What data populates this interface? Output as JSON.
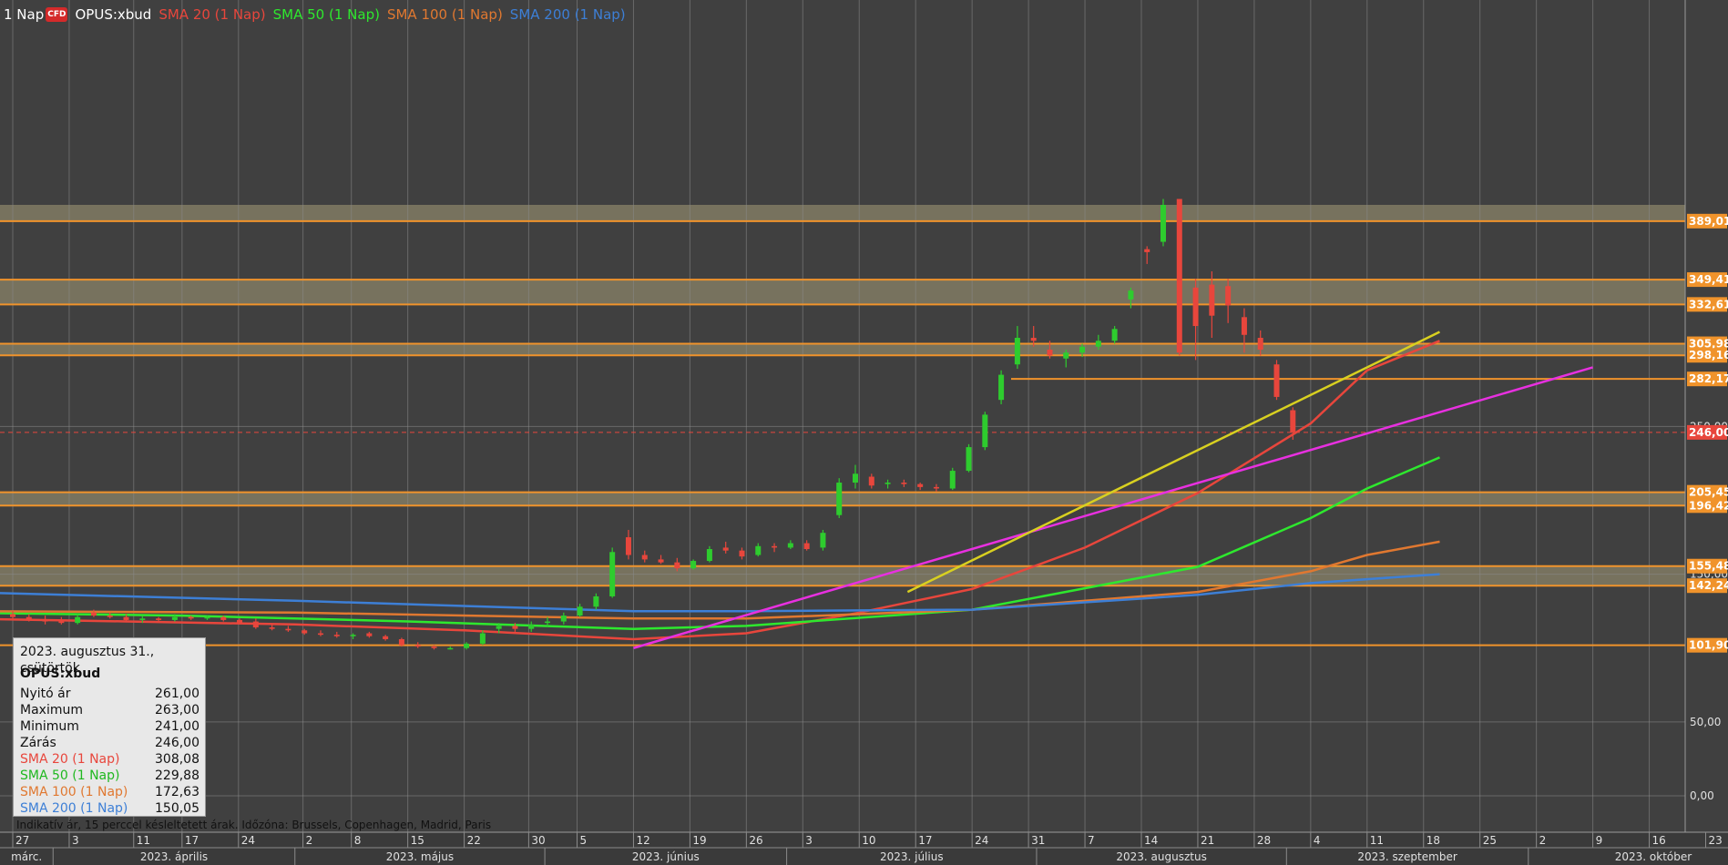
{
  "header": {
    "timeframe": "1 Nap",
    "badge": "CFD",
    "symbol": "OPUS:xbud",
    "indicators": [
      {
        "label": "SMA 20 (1 Nap)",
        "color": "#e8463c"
      },
      {
        "label": "SMA 50 (1 Nap)",
        "color": "#2ee82e"
      },
      {
        "label": "SMA 100 (1 Nap)",
        "color": "#e07830"
      },
      {
        "label": "SMA 200 (1 Nap)",
        "color": "#3d7fd6"
      }
    ]
  },
  "info_box": {
    "date": "2023. augusztus 31., csütörtök",
    "symbol": "OPUS:xbud",
    "rows": [
      {
        "label": "Nyitó ár",
        "value": "261,00",
        "color": "#111111"
      },
      {
        "label": "Maximum",
        "value": "263,00",
        "color": "#111111"
      },
      {
        "label": "Minimum",
        "value": "241,00",
        "color": "#111111"
      },
      {
        "label": "Zárás",
        "value": "246,00",
        "color": "#111111"
      },
      {
        "label": "SMA 20 (1 Nap)",
        "value": "308,08",
        "color": "#e8463c"
      },
      {
        "label": "SMA 50 (1 Nap)",
        "value": "229,88",
        "color": "#2ee82e"
      },
      {
        "label": "SMA 100 (1 Nap)",
        "value": "172,63",
        "color": "#e07830"
      },
      {
        "label": "SMA 200 (1 Nap)",
        "value": "150,05",
        "color": "#3d7fd6"
      }
    ]
  },
  "disclaimer": "Indikatív ár, 15 perccel késleltetett árak.   Időzóna: Brussels, Copenhagen, Madrid, Paris",
  "colors": {
    "background": "#404040",
    "grid": "#8a8a8a",
    "up_candle": "#2ecc2e",
    "down_candle": "#e8463c",
    "level_line": "#f0932b",
    "level_band": "#7a7560",
    "support_line": "#e830e0",
    "trend_line": "#d8d020"
  },
  "chart_data": {
    "type": "candlestick",
    "y_axis": {
      "min": 0,
      "max": 400,
      "tick_labels": [
        "0,00",
        "50,00",
        "150,00",
        "250,00"
      ]
    },
    "x_axis": {
      "days": [
        "27",
        "3",
        "11",
        "17",
        "24",
        "2",
        "8",
        "15",
        "22",
        "30",
        "5",
        "12",
        "19",
        "26",
        "3",
        "10",
        "17",
        "24",
        "31",
        "7",
        "14",
        "21",
        "28",
        "4",
        "11",
        "18",
        "25",
        "2",
        "9",
        "16",
        "23"
      ],
      "months": [
        "márc.",
        "2023. április",
        "2023. május",
        "2023. június",
        "2023. július",
        "2023. augusztus",
        "2023. szeptember",
        "2023. október"
      ]
    },
    "price_levels": [
      {
        "value": 389.01,
        "label": "389,01"
      },
      {
        "value": 349.41,
        "label": "349,41"
      },
      {
        "value": 332.61,
        "label": "332,61"
      },
      {
        "value": 305.98,
        "label": "305,98"
      },
      {
        "value": 298.16,
        "label": "298,16"
      },
      {
        "value": 282.17,
        "label": "282,17"
      },
      {
        "value": 205.45,
        "label": "205,45"
      },
      {
        "value": 196.42,
        "label": "196,42"
      },
      {
        "value": 155.48,
        "label": "155,48"
      },
      {
        "value": 142.24,
        "label": "142,24"
      },
      {
        "value": 101.9,
        "label": "101,90"
      }
    ],
    "current_price": {
      "value": 246.0,
      "label": "246,00"
    },
    "bands": [
      {
        "from": 389.01,
        "to": 400
      },
      {
        "from": 332.61,
        "to": 349.41
      },
      {
        "from": 298.16,
        "to": 305.98
      },
      {
        "from": 196.42,
        "to": 205.45
      },
      {
        "from": 142.24,
        "to": 155.48
      }
    ],
    "candles": [
      {
        "date": "2023-03-27",
        "o": 123,
        "h": 125,
        "l": 120,
        "c": 121
      },
      {
        "date": "2023-03-29",
        "o": 121,
        "h": 123,
        "l": 118,
        "c": 119
      },
      {
        "date": "2023-03-31",
        "o": 119,
        "h": 122,
        "l": 116,
        "c": 118
      },
      {
        "date": "2023-04-03",
        "o": 118,
        "h": 121,
        "l": 116,
        "c": 117
      },
      {
        "date": "2023-04-05",
        "o": 117,
        "h": 123,
        "l": 116,
        "c": 121
      },
      {
        "date": "2023-04-11",
        "o": 124,
        "h": 126,
        "l": 121,
        "c": 122
      },
      {
        "date": "2023-04-13",
        "o": 122,
        "h": 124,
        "l": 120,
        "c": 121
      },
      {
        "date": "2023-04-17",
        "o": 121,
        "h": 123,
        "l": 118,
        "c": 119
      },
      {
        "date": "2023-04-19",
        "o": 119,
        "h": 122,
        "l": 117,
        "c": 120
      },
      {
        "date": "2023-04-21",
        "o": 120,
        "h": 121,
        "l": 118,
        "c": 119
      },
      {
        "date": "2023-04-24",
        "o": 119,
        "h": 123,
        "l": 118,
        "c": 121
      },
      {
        "date": "2023-04-26",
        "o": 121,
        "h": 122,
        "l": 119,
        "c": 120
      },
      {
        "date": "2023-04-28",
        "o": 120,
        "h": 122,
        "l": 119,
        "c": 121
      },
      {
        "date": "2023-05-02",
        "o": 121,
        "h": 122,
        "l": 118,
        "c": 119
      },
      {
        "date": "2023-05-04",
        "o": 119,
        "h": 120,
        "l": 116,
        "c": 117
      },
      {
        "date": "2023-05-08",
        "o": 118,
        "h": 120,
        "l": 113,
        "c": 114
      },
      {
        "date": "2023-05-10",
        "o": 114,
        "h": 116,
        "l": 112,
        "c": 113
      },
      {
        "date": "2023-05-12",
        "o": 113,
        "h": 115,
        "l": 111,
        "c": 112
      },
      {
        "date": "2023-05-15",
        "o": 112,
        "h": 113,
        "l": 109,
        "c": 110
      },
      {
        "date": "2023-05-17",
        "o": 110,
        "h": 112,
        "l": 108,
        "c": 109
      },
      {
        "date": "2023-05-19",
        "o": 109,
        "h": 111,
        "l": 107,
        "c": 108
      },
      {
        "date": "2023-05-22",
        "o": 108,
        "h": 110,
        "l": 106,
        "c": 109
      },
      {
        "date": "2023-05-24",
        "o": 110,
        "h": 111,
        "l": 107,
        "c": 108
      },
      {
        "date": "2023-05-26",
        "o": 108,
        "h": 109,
        "l": 105,
        "c": 106
      },
      {
        "date": "2023-05-30",
        "o": 106,
        "h": 107,
        "l": 101,
        "c": 102
      },
      {
        "date": "2023-06-01",
        "o": 102,
        "h": 104,
        "l": 100,
        "c": 101
      },
      {
        "date": "2023-06-05",
        "o": 101,
        "h": 102,
        "l": 99,
        "c": 100
      },
      {
        "date": "2023-06-07",
        "o": 100,
        "h": 101,
        "l": 99,
        "c": 100
      },
      {
        "date": "2023-06-09",
        "o": 100,
        "h": 104,
        "l": 99,
        "c": 103
      },
      {
        "date": "2023-06-12",
        "o": 103,
        "h": 112,
        "l": 102,
        "c": 110
      },
      {
        "date": "2023-06-14",
        "o": 113,
        "h": 117,
        "l": 110,
        "c": 115
      },
      {
        "date": "2023-06-16",
        "o": 115,
        "h": 117,
        "l": 111,
        "c": 113
      },
      {
        "date": "2023-06-19",
        "o": 113,
        "h": 118,
        "l": 111,
        "c": 116
      },
      {
        "date": "2023-06-21",
        "o": 117,
        "h": 121,
        "l": 114,
        "c": 118
      },
      {
        "date": "2023-06-23",
        "o": 118,
        "h": 124,
        "l": 116,
        "c": 122
      },
      {
        "date": "2023-06-26",
        "o": 122,
        "h": 130,
        "l": 121,
        "c": 128
      },
      {
        "date": "2023-06-28",
        "o": 128,
        "h": 137,
        "l": 126,
        "c": 135
      },
      {
        "date": "2023-06-30",
        "o": 135,
        "h": 168,
        "l": 134,
        "c": 165
      },
      {
        "date": "2023-07-03",
        "o": 175,
        "h": 180,
        "l": 160,
        "c": 163
      },
      {
        "date": "2023-07-05",
        "o": 163,
        "h": 166,
        "l": 158,
        "c": 160
      },
      {
        "date": "2023-07-07",
        "o": 160,
        "h": 163,
        "l": 157,
        "c": 158
      },
      {
        "date": "2023-07-10",
        "o": 158,
        "h": 161,
        "l": 152,
        "c": 154
      },
      {
        "date": "2023-07-12",
        "o": 154,
        "h": 160,
        "l": 153,
        "c": 159
      },
      {
        "date": "2023-07-14",
        "o": 159,
        "h": 169,
        "l": 158,
        "c": 167
      },
      {
        "date": "2023-07-17",
        "o": 168,
        "h": 172,
        "l": 164,
        "c": 166
      },
      {
        "date": "2023-07-19",
        "o": 166,
        "h": 168,
        "l": 160,
        "c": 162
      },
      {
        "date": "2023-07-21",
        "o": 163,
        "h": 171,
        "l": 162,
        "c": 169
      },
      {
        "date": "2023-07-24",
        "o": 169,
        "h": 171,
        "l": 165,
        "c": 168
      },
      {
        "date": "2023-07-26",
        "o": 168,
        "h": 173,
        "l": 167,
        "c": 171
      },
      {
        "date": "2023-07-28",
        "o": 171,
        "h": 173,
        "l": 166,
        "c": 167
      },
      {
        "date": "2023-07-31",
        "o": 168,
        "h": 180,
        "l": 166,
        "c": 178
      },
      {
        "date": "2023-08-02",
        "o": 190,
        "h": 215,
        "l": 188,
        "c": 212
      },
      {
        "date": "2023-08-04",
        "o": 212,
        "h": 224,
        "l": 208,
        "c": 218
      },
      {
        "date": "2023-08-07",
        "o": 216,
        "h": 218,
        "l": 208,
        "c": 210
      },
      {
        "date": "2023-08-09",
        "o": 211,
        "h": 214,
        "l": 208,
        "c": 212
      },
      {
        "date": "2023-08-11",
        "o": 212,
        "h": 214,
        "l": 209,
        "c": 211
      },
      {
        "date": "2023-08-14",
        "o": 211,
        "h": 212,
        "l": 207,
        "c": 209
      },
      {
        "date": "2023-08-16",
        "o": 209,
        "h": 211,
        "l": 206,
        "c": 208
      },
      {
        "date": "2023-08-18",
        "o": 208,
        "h": 222,
        "l": 207,
        "c": 220
      },
      {
        "date": "2023-08-21",
        "o": 220,
        "h": 238,
        "l": 219,
        "c": 236
      },
      {
        "date": "2023-08-23",
        "o": 236,
        "h": 260,
        "l": 234,
        "c": 258
      },
      {
        "date": "2023-08-25",
        "o": 268,
        "h": 288,
        "l": 265,
        "c": 285
      },
      {
        "date": "2023-08-28",
        "o": 292,
        "h": 318,
        "l": 289,
        "c": 310
      },
      {
        "date": "2023-08-29",
        "o": 310,
        "h": 318,
        "l": 304,
        "c": 308
      },
      {
        "date": "2023-08-30",
        "o": 302,
        "h": 308,
        "l": 296,
        "c": 298
      },
      {
        "date": "2023-08-31",
        "o": 296,
        "h": 302,
        "l": 290,
        "c": 300
      },
      {
        "date": "2023-09-01",
        "o": 300,
        "h": 306,
        "l": 297,
        "c": 304
      },
      {
        "date": "2023-09-04",
        "o": 304,
        "h": 312,
        "l": 302,
        "c": 308
      },
      {
        "date": "2023-09-05",
        "o": 308,
        "h": 318,
        "l": 306,
        "c": 316
      },
      {
        "date": "2023-09-06",
        "o": 336,
        "h": 344,
        "l": 330,
        "c": 342
      },
      {
        "date": "2023-09-07",
        "o": 370,
        "h": 372,
        "l": 360,
        "c": 368
      },
      {
        "date": "2023-09-08",
        "o": 375,
        "h": 404,
        "l": 372,
        "c": 400
      },
      {
        "date": "2023-09-11",
        "o": 404,
        "h": 404,
        "l": 298,
        "c": 300
      },
      {
        "date": "2023-09-12",
        "o": 344,
        "h": 350,
        "l": 295,
        "c": 318
      },
      {
        "date": "2023-09-13",
        "o": 346,
        "h": 355,
        "l": 310,
        "c": 325
      },
      {
        "date": "2023-09-14",
        "o": 345,
        "h": 350,
        "l": 320,
        "c": 332
      },
      {
        "date": "2023-09-15",
        "o": 324,
        "h": 330,
        "l": 300,
        "c": 312
      },
      {
        "date": "2023-09-18",
        "o": 310,
        "h": 315,
        "l": 298,
        "c": 302
      },
      {
        "date": "2023-09-19",
        "o": 292,
        "h": 295,
        "l": 268,
        "c": 270
      },
      {
        "date": "2023-09-20",
        "o": 261,
        "h": 263,
        "l": 241,
        "c": 246
      }
    ],
    "sma_lines": [
      {
        "name": "SMA 20 (1 Nap)",
        "color": "#e8463c",
        "points": [
          [
            "2023-03-20",
            120
          ],
          [
            "2023-04-10",
            118
          ],
          [
            "2023-05-01",
            116
          ],
          [
            "2023-05-22",
            112
          ],
          [
            "2023-06-12",
            106
          ],
          [
            "2023-06-26",
            110
          ],
          [
            "2023-07-10",
            124
          ],
          [
            "2023-07-24",
            140
          ],
          [
            "2023-08-07",
            168
          ],
          [
            "2023-08-21",
            205
          ],
          [
            "2023-09-04",
            252
          ],
          [
            "2023-09-11",
            288
          ],
          [
            "2023-09-20",
            308
          ]
        ]
      },
      {
        "name": "SMA 50 (1 Nap)",
        "color": "#2ee82e",
        "points": [
          [
            "2023-03-20",
            124
          ],
          [
            "2023-04-17",
            122
          ],
          [
            "2023-05-15",
            118
          ],
          [
            "2023-06-12",
            113
          ],
          [
            "2023-06-26",
            115
          ],
          [
            "2023-07-24",
            126
          ],
          [
            "2023-08-21",
            155
          ],
          [
            "2023-09-04",
            188
          ],
          [
            "2023-09-11",
            208
          ],
          [
            "2023-09-20",
            229
          ]
        ]
      },
      {
        "name": "SMA 100 (1 Nap)",
        "color": "#e07830",
        "points": [
          [
            "2023-03-20",
            125
          ],
          [
            "2023-05-01",
            124
          ],
          [
            "2023-06-12",
            120
          ],
          [
            "2023-06-26",
            120
          ],
          [
            "2023-07-24",
            126
          ],
          [
            "2023-08-21",
            138
          ],
          [
            "2023-09-04",
            152
          ],
          [
            "2023-09-11",
            163
          ],
          [
            "2023-09-20",
            172
          ]
        ]
      },
      {
        "name": "SMA 200 (1 Nap)",
        "color": "#3d7fd6",
        "points": [
          [
            "2023-03-20",
            138
          ],
          [
            "2023-05-01",
            132
          ],
          [
            "2023-06-12",
            125
          ],
          [
            "2023-06-26",
            125
          ],
          [
            "2023-07-24",
            126
          ],
          [
            "2023-08-21",
            136
          ],
          [
            "2023-09-04",
            144
          ],
          [
            "2023-09-20",
            150
          ]
        ]
      }
    ],
    "trend_lines": [
      {
        "color": "#e830e0",
        "from": [
          "2023-06-12",
          100
        ],
        "to": [
          "2023-10-09",
          290
        ]
      },
      {
        "color": "#d8d020",
        "from": [
          "2023-07-16",
          138
        ],
        "to": [
          "2023-09-20",
          314
        ]
      }
    ]
  }
}
